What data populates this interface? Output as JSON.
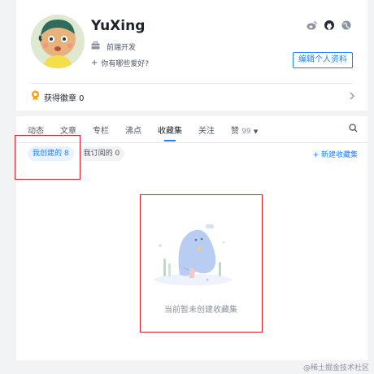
{
  "profile": {
    "username": "YuXing",
    "job_title": "前端开发",
    "hobby_prompt": "你有哪些爱好?",
    "edit_button_label": "编辑个人资料",
    "socials": [
      "weibo-icon",
      "github-icon",
      "globe-icon"
    ]
  },
  "badges": {
    "label": "获得徽章 0"
  },
  "tabs": {
    "items": [
      {
        "label": "动态"
      },
      {
        "label": "文章"
      },
      {
        "label": "专栏"
      },
      {
        "label": "沸点"
      },
      {
        "label": "收藏集",
        "active": true
      },
      {
        "label": "关注"
      }
    ],
    "likes": {
      "label": "赞",
      "count": "99"
    }
  },
  "subtabs": {
    "created": "我创建的 8",
    "subscribed": "我订阅的 0"
  },
  "new_folder_label": "+ 新建收藏集",
  "empty_state": {
    "text": "当前暂未创建收藏集"
  },
  "watermark": "@稀土掘金技术社区",
  "colors": {
    "accent": "#1e80ff",
    "highlight_box": "#e0202a"
  }
}
